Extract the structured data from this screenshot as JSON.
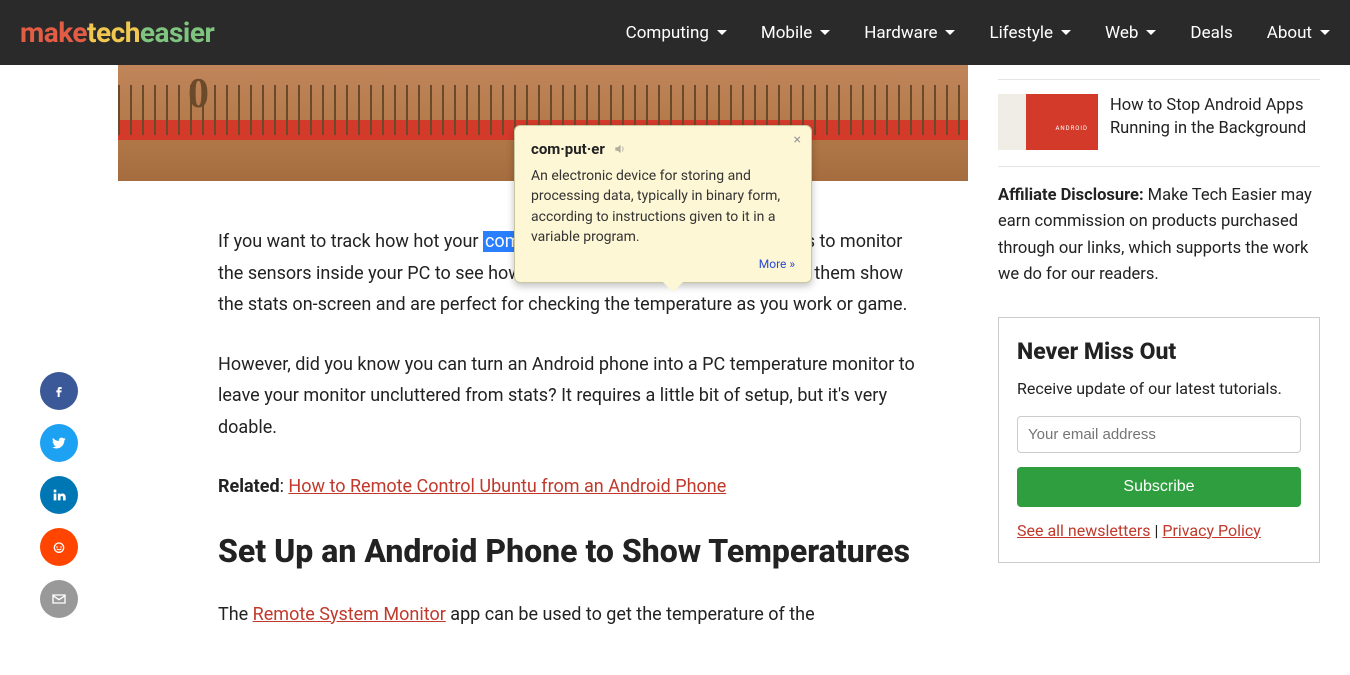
{
  "nav": {
    "logo": {
      "part1": "make",
      "part2": "tech",
      "part3": "easier"
    },
    "items": [
      "Computing",
      "Mobile",
      "Hardware",
      "Lifestyle",
      "Web",
      "Deals",
      "About"
    ],
    "dropdown_indices": [
      0,
      1,
      2,
      3,
      4,
      6
    ]
  },
  "tooltip": {
    "word": "com·put·er",
    "definition": "An electronic device for storing and processing data, typically in binary form, according to instructions given to it in a variable program.",
    "more": "More »"
  },
  "article": {
    "p1_pre": "If you want to track how hot your ",
    "p1_hl": "computer",
    "p1_post": " is getting, there are many ways to monitor the sensors inside your PC to see how toasty your processors are. Most of them show the stats on-screen and are perfect for checking the temperature as you work or game.",
    "p2": "However, did you know you can turn an Android phone into a PC temperature monitor to leave your monitor uncluttered from stats? It requires a little bit of setup, but it's very doable.",
    "related_label": "Related",
    "related_link": "How to Remote Control Ubuntu from an Android Phone",
    "h2": "Set Up an Android Phone to Show Temperatures",
    "p3_pre": "The ",
    "p3_link": "Remote System Monitor",
    "p3_post": " app can be used to get the temperature of the"
  },
  "sidebar": {
    "item1_title": "How to Stop Android Apps Running in the Background",
    "thumb_label": "ANDROID",
    "affiliate_label": "Affiliate Disclosure:",
    "affiliate_text": " Make Tech Easier may earn commission on products purchased through our links, which supports the work we do for our readers.",
    "newsletter": {
      "heading": "Never Miss Out",
      "sub": "Receive update of our latest tutorials.",
      "placeholder": "Your email address",
      "button": "Subscribe",
      "link1": "See all newsletters",
      "sep": " | ",
      "link2": "Privacy Policy"
    }
  }
}
